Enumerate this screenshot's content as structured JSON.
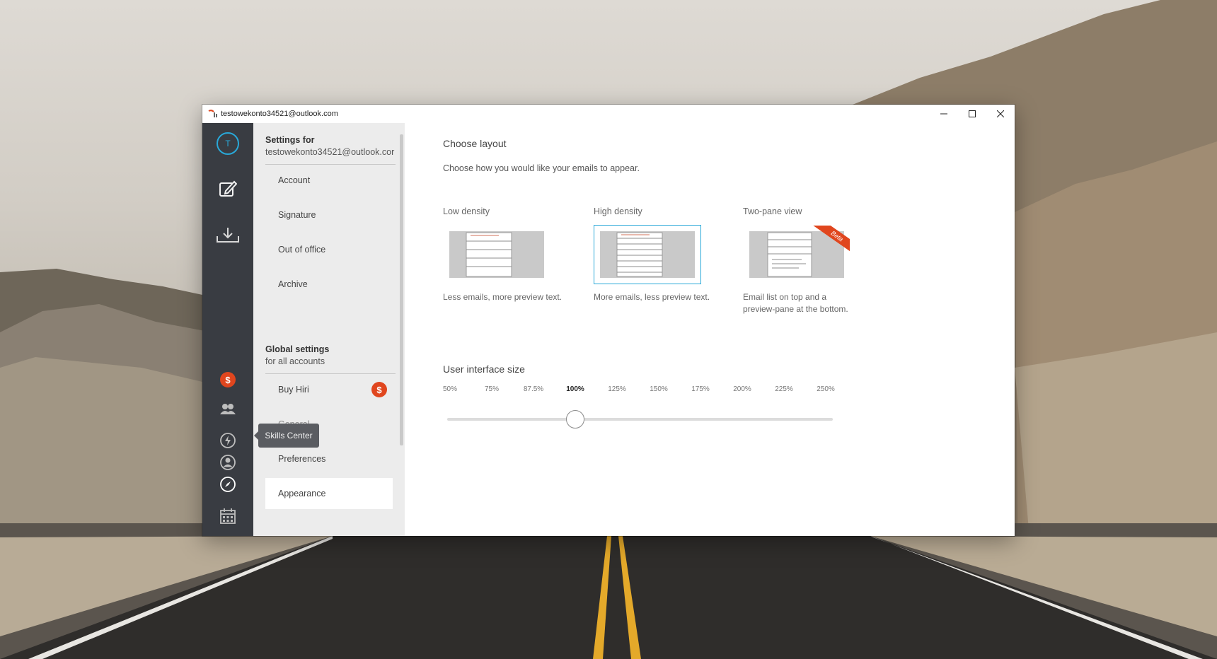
{
  "window": {
    "title": "testowekonto34521@outlook.com",
    "controls": [
      "minimize",
      "maximize",
      "close"
    ]
  },
  "rail": {
    "avatar_letter": "T",
    "icons": [
      "compose-icon",
      "inbox-download-icon",
      "dollar-icon",
      "contacts-icon",
      "lightning-icon",
      "user-icon",
      "compass-icon",
      "calendar-icon"
    ],
    "tooltip": "Skills Center"
  },
  "sidebar": {
    "account_group": {
      "title": "Settings for",
      "subtitle": "testowekonto34521@outlook.cor",
      "items": [
        {
          "label": "Account"
        },
        {
          "label": "Signature"
        },
        {
          "label": "Out of office"
        },
        {
          "label": "Archive"
        }
      ]
    },
    "global_group": {
      "title": "Global settings",
      "subtitle": "for all accounts",
      "items": [
        {
          "label": "Buy Hiri"
        },
        {
          "label": "General"
        },
        {
          "label": "Preferences"
        },
        {
          "label": "Appearance"
        }
      ]
    },
    "active_item": "Appearance"
  },
  "main": {
    "layout_heading": "Choose layout",
    "layout_subtext": "Choose how you would like your emails to appear.",
    "options": [
      {
        "label": "Low density",
        "description": "Less emails, more preview text.",
        "selected": false
      },
      {
        "label": "High density",
        "description": "More emails, less preview text.",
        "selected": true
      },
      {
        "label": "Two-pane view",
        "description": "Email list on top and a preview-pane at the bottom.",
        "selected": false,
        "badge": "Beta"
      }
    ],
    "size_heading": "User interface size",
    "scale": [
      "50%",
      "75%",
      "87.5%",
      "100%",
      "125%",
      "150%",
      "175%",
      "200%",
      "225%",
      "250%"
    ],
    "scale_value": "100%"
  },
  "colors": {
    "accent": "#29a8d8",
    "rail_bg": "#393c42",
    "sidebar_bg": "#ececec",
    "badge": "#e0461e"
  }
}
